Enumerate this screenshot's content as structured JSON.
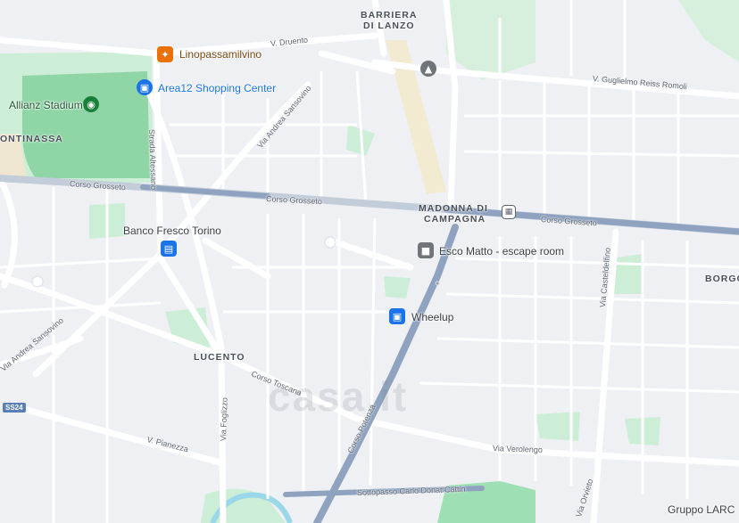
{
  "areas": {
    "barriera": "BARRIERA",
    "di_lanzo": "DI LANZO",
    "continassa": "ONTINASSA",
    "madonna": "MADONNA DI",
    "campagna": "CAMPAGNA",
    "lucento": "LUCENTO",
    "borgo": "BORGO"
  },
  "streets": {
    "v_druento": "V. Druento",
    "v_reiss": "V. Guglielmo Reiss Romoli",
    "via_sansovino_top": "Via Andrea Sansovino",
    "strada_altessano": "Strada Altessano",
    "corso_grosseto_w": "Corso Grosseto",
    "corso_grosseto_mid": "Corso Grosseto",
    "corso_grosseto_e": "Corso Grosseto",
    "via_casteldelfino": "Via Casteldelfino",
    "corso_toscana": "Corso Toscana",
    "via_foglizzo": "Via Foglizzo",
    "via_sansovino_low": "Via Andrea Sansovino",
    "v_pianezza": "V. Pianezza",
    "corso_potenza": "Corso Potenza",
    "via_verolengo": "Via Verolengo",
    "sottopasso": "Sottopasso Carlo Donat Cattin",
    "via_orvieto": "Via Orvieto",
    "ss24": "SS24"
  },
  "pois": {
    "linopassamilvino": "Linopassamilvino",
    "area12": "Area12 Shopping Center",
    "allianz": "Allianz Stadium",
    "banco_fresco": "Banco Fresco Torino",
    "esco_matto": "Esco Matto - escape room",
    "wheelup": "Wheelup",
    "gruppo_larc": "Gruppo LARC"
  },
  "icons": {
    "restaurant": "restaurant-icon",
    "shopping": "shopping-bag-icon",
    "stadium": "stadium-icon",
    "cart": "shopping-cart-icon",
    "escape": "escape-room-icon",
    "school": "school-icon",
    "transit": "transit-icon"
  },
  "watermark": "casa.it",
  "colors": {
    "park": "#cdeed6",
    "stadium_green": "#8fd5a6",
    "arterial": "#8fa3c0",
    "road": "#ffffff",
    "background": "#eef0f4",
    "water": "#9ad7e8",
    "poi_blue": "#1a73e8",
    "poi_orange": "#e8710a",
    "poi_gray": "#70757a"
  }
}
